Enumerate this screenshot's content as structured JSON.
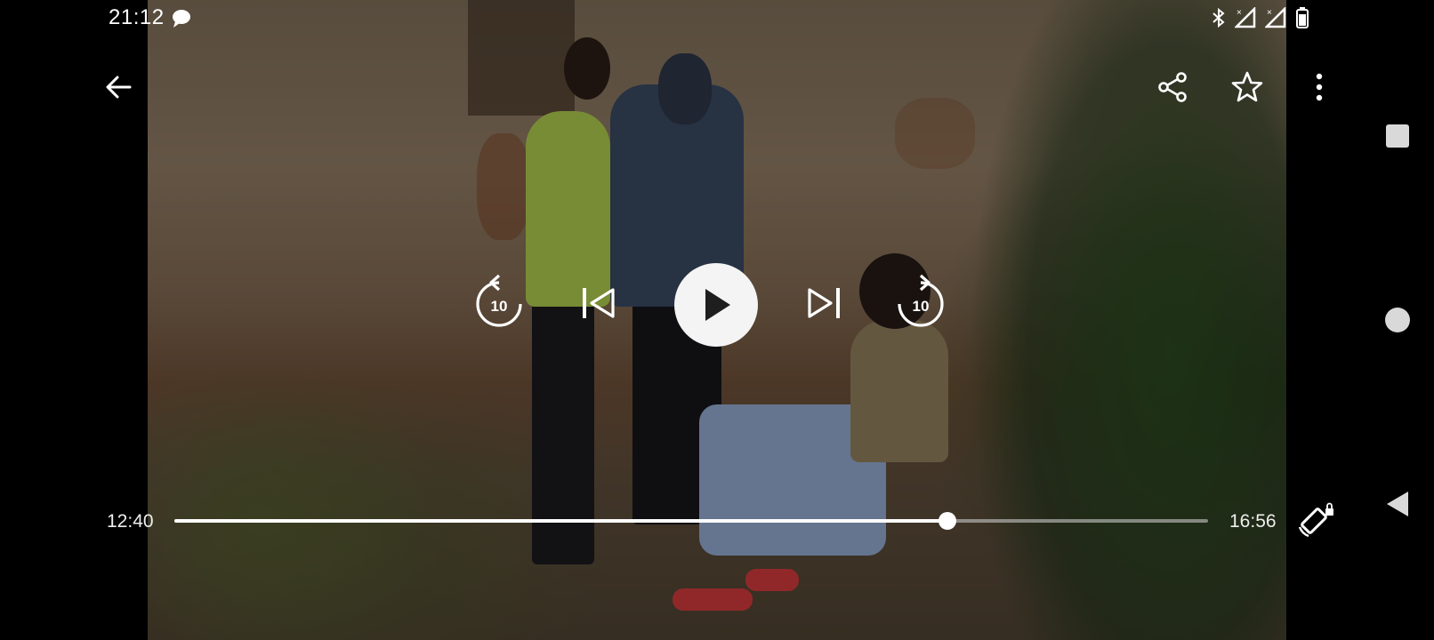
{
  "status_bar": {
    "time": "21:12",
    "icons": [
      "chat-bubble-icon",
      "bluetooth-icon",
      "signal-no-data-icon",
      "signal-no-data-icon",
      "battery-icon"
    ]
  },
  "toolbar": {
    "back_icon": "arrow-back-icon",
    "share_icon": "share-icon",
    "favorite_icon": "star-outline-icon",
    "more_icon": "more-vert-icon"
  },
  "controls": {
    "rewind_seconds": "10",
    "forward_seconds": "10",
    "state": "paused"
  },
  "seek": {
    "position": "12:40",
    "duration": "16:56",
    "progress": 0.748
  },
  "colors": {
    "control": "#ffffff",
    "play_button_bg": "#f4f4f4",
    "track": "#c8c8c8"
  }
}
